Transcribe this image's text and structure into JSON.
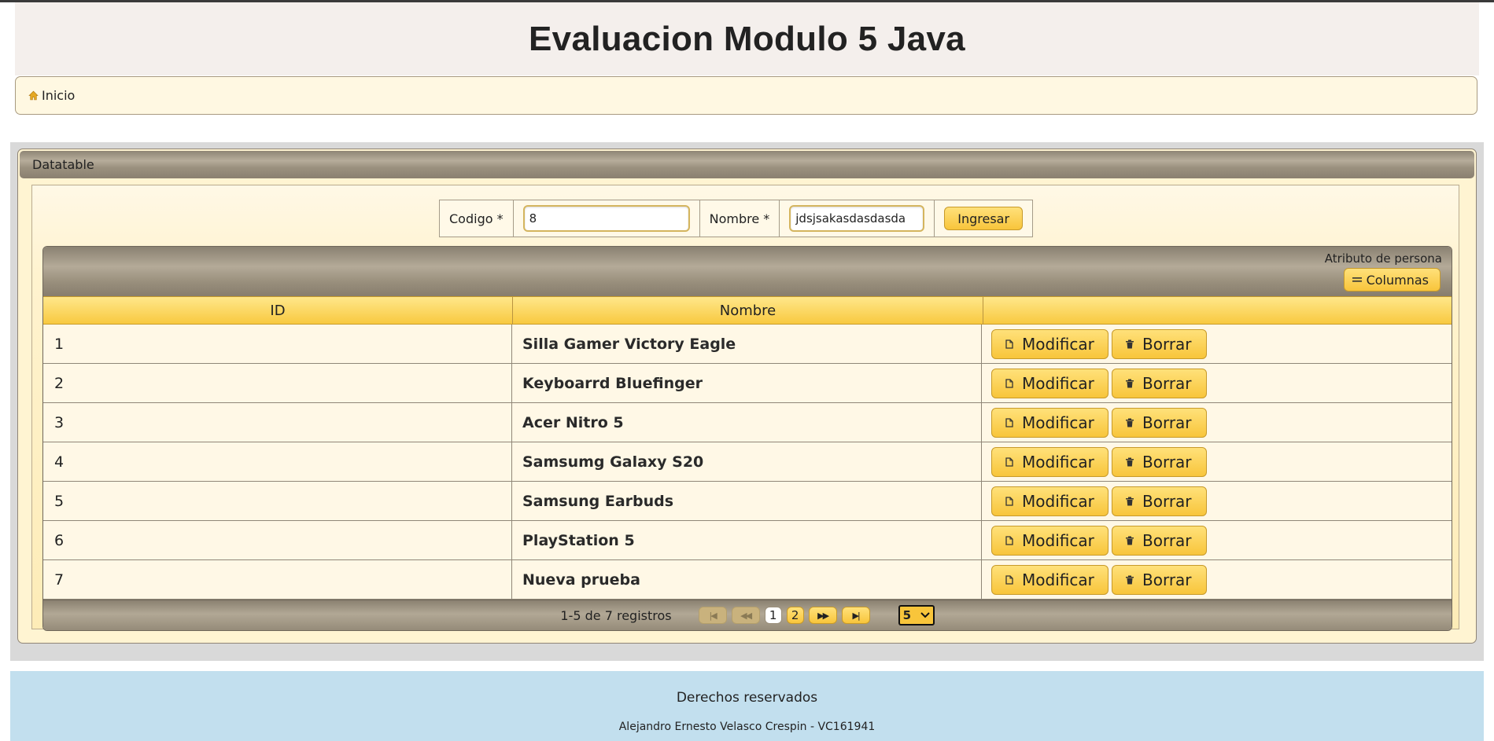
{
  "header": {
    "title": "Evaluacion Modulo 5 Java"
  },
  "breadcrumb": {
    "home_label": "Inicio",
    "icon": "home-icon"
  },
  "panel": {
    "title": "Datatable"
  },
  "form": {
    "codigo_label": "Codigo *",
    "codigo_value": "8",
    "nombre_label": "Nombre *",
    "nombre_value": "jdsjsakasdasdasda",
    "submit_label": "Ingresar"
  },
  "table": {
    "caption": "Atributo de persona",
    "columns_button": "Columnas",
    "headers": [
      "ID",
      "Nombre",
      ""
    ],
    "rows": [
      {
        "id": "1",
        "nombre": "Silla Gamer Victory Eagle"
      },
      {
        "id": "2",
        "nombre": "Keyboarrd Bluefinger"
      },
      {
        "id": "3",
        "nombre": "Acer Nitro 5"
      },
      {
        "id": "4",
        "nombre": "Samsumg Galaxy S20"
      },
      {
        "id": "5",
        "nombre": "Samsung Earbuds"
      },
      {
        "id": "6",
        "nombre": "PlayStation 5"
      },
      {
        "id": "7",
        "nombre": "Nueva prueba"
      }
    ],
    "modify_label": "Modificar",
    "delete_label": "Borrar",
    "paginator": {
      "info": "1-5 de 7 registros",
      "pages": [
        "1",
        "2"
      ],
      "current_page": "1",
      "rows_per_page": "5"
    }
  },
  "footer": {
    "rights": "Derechos reservados",
    "author": "Alejandro Ernesto Velasco Crespin - VC161941"
  },
  "colors": {
    "accent_gold": "#f8c53b",
    "panel_bg": "#fff4d2",
    "footer_bg": "#c2dfee"
  }
}
